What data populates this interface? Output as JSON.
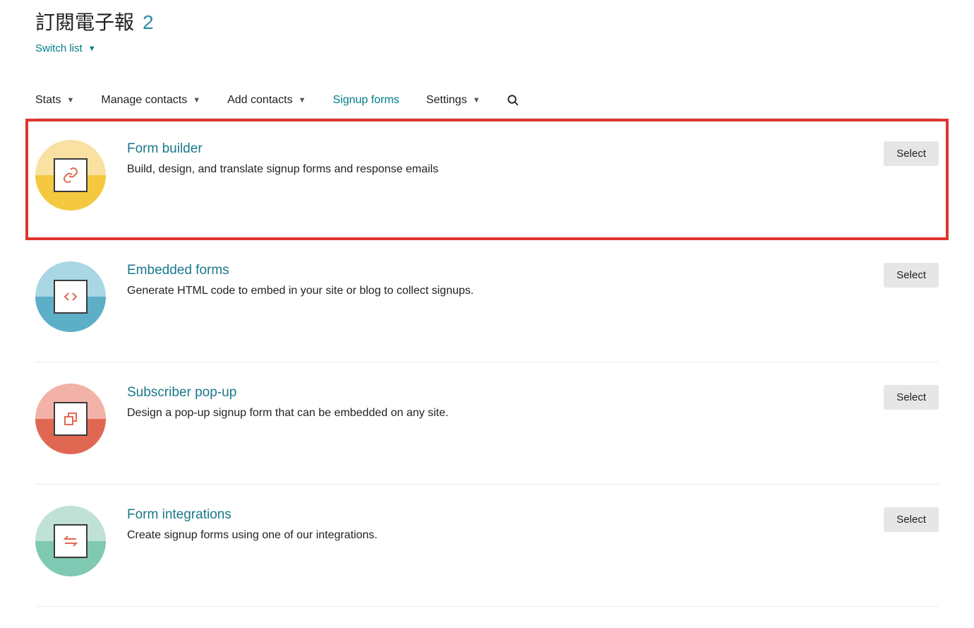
{
  "header": {
    "title": "訂閱電子報",
    "count": "2",
    "switch_list": "Switch list"
  },
  "tabs": {
    "stats": "Stats",
    "manage_contacts": "Manage contacts",
    "add_contacts": "Add contacts",
    "signup_forms": "Signup forms",
    "settings": "Settings"
  },
  "cards": [
    {
      "title": "Form builder",
      "desc": "Build, design, and translate signup forms and response emails",
      "select": "Select"
    },
    {
      "title": "Embedded forms",
      "desc": "Generate HTML code to embed in your site or blog to collect signups.",
      "select": "Select"
    },
    {
      "title": "Subscriber pop-up",
      "desc": "Design a pop-up signup form that can be embedded on any site.",
      "select": "Select"
    },
    {
      "title": "Form integrations",
      "desc": "Create signup forms using one of our integrations.",
      "select": "Select"
    }
  ],
  "colors": {
    "card0_top": "#f8e1a1",
    "card0_bot": "#f5c93f",
    "card1_top": "#a9d7e3",
    "card1_bot": "#5cafc6",
    "card2_top": "#f2b2a7",
    "card2_bot": "#e06852",
    "card3_top": "#bfe1d6",
    "card3_bot": "#7fc9b2"
  }
}
